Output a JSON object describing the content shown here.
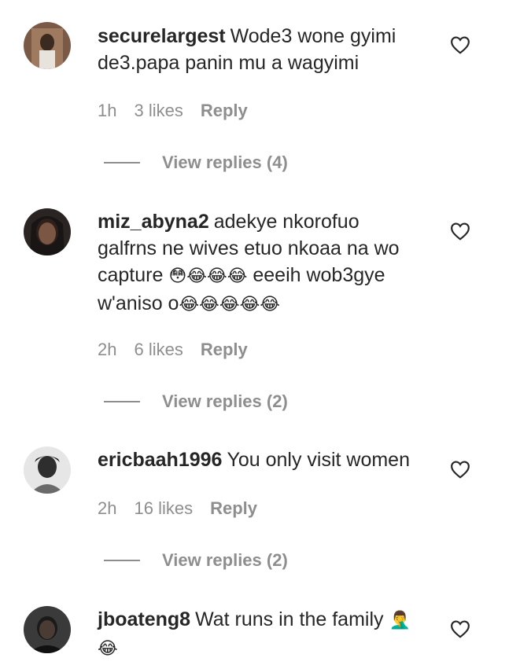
{
  "comments": [
    {
      "username": "securelargest",
      "text_lines": [
        "Wode3 wone gyimi",
        "de3.papa panin mu a wagyimi"
      ],
      "time": "1h",
      "likes": "3 likes",
      "reply_label": "Reply",
      "view_replies": "View replies (4)",
      "avatar_icon": "user-avatar"
    },
    {
      "username": "miz_abyna2",
      "text_lines": [
        "adekye nkorofuo",
        "galfrns ne wives etuo nkoaa na wo",
        "capture",
        "eeeih wob3gye",
        "w'aniso o"
      ],
      "emojis_line3": "😳😂😂😂",
      "emojis_line4": "😂😂😂😂😂",
      "time": "2h",
      "likes": "6 likes",
      "reply_label": "Reply",
      "view_replies": "View replies (2)",
      "avatar_icon": "user-avatar"
    },
    {
      "username": "ericbaah1996",
      "text_lines": [
        "You only visit women"
      ],
      "time": "2h",
      "likes": "16 likes",
      "reply_label": "Reply",
      "view_replies": "View replies (2)",
      "avatar_icon": "user-avatar"
    },
    {
      "username": "jboateng8",
      "text_lines": [
        "Wat runs in the family"
      ],
      "emoji_inline": "🤦‍♂️",
      "emoji_line2": "😂",
      "avatar_icon": "user-avatar"
    }
  ],
  "icons": {
    "like": "heart-outline-icon"
  },
  "colors": {
    "text": "#262626",
    "muted": "#8e8e8e",
    "background": "#ffffff"
  }
}
